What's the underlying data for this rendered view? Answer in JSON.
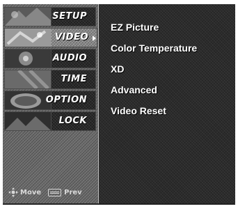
{
  "sidebar": {
    "items": [
      {
        "label": "SETUP",
        "icon": "setup-thumbnail-icon"
      },
      {
        "label": "VIDEO",
        "icon": "video-thumbnail-icon",
        "selected": true
      },
      {
        "label": "AUDIO",
        "icon": "audio-thumbnail-icon"
      },
      {
        "label": "TIME",
        "icon": "time-thumbnail-icon"
      },
      {
        "label": "OPTION",
        "icon": "option-thumbnail-icon"
      },
      {
        "label": "LOCK",
        "icon": "lock-thumbnail-icon"
      }
    ]
  },
  "submenu": {
    "items": [
      "EZ Picture",
      "Color Temperature",
      "XD",
      "Advanced",
      "Video Reset"
    ]
  },
  "footer": {
    "move_label": "Move",
    "prev_label": "Prev"
  },
  "colors": {
    "text": "#ffffff",
    "panel": "#262626",
    "sidebar": "#6e6e6e",
    "selected_item": "#8a8a8a"
  }
}
